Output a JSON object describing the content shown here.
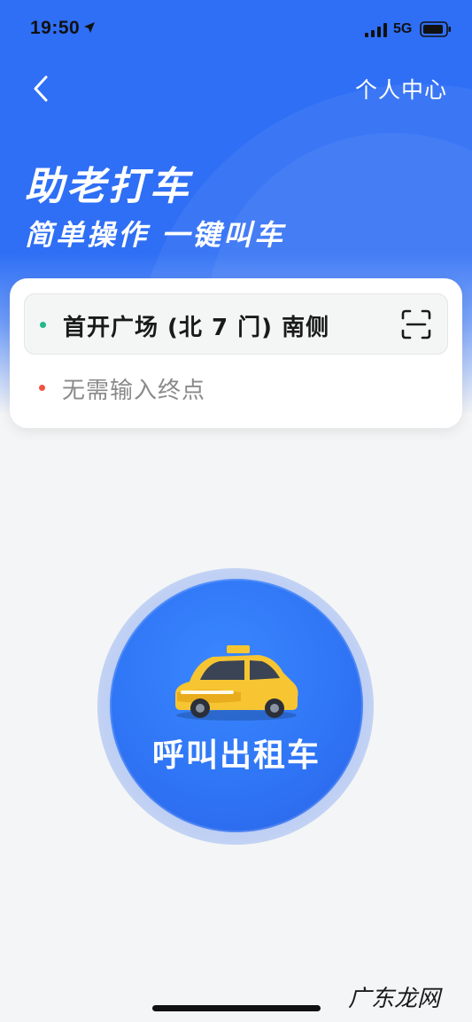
{
  "status": {
    "time": "19:50",
    "network": "5G"
  },
  "header": {
    "user_center": "个人中心"
  },
  "hero": {
    "title": "助老打车",
    "subtitle": "简单操作 一键叫车"
  },
  "route": {
    "origin": "首开广场 (北 7 门) 南侧",
    "destination_placeholder": "无需输入终点"
  },
  "call": {
    "label": "呼叫出租车"
  },
  "watermark": "广东龙网",
  "colors": {
    "primary": "#2f6ff5",
    "origin_dot": "#20b98a",
    "destination_dot": "#f25242",
    "taxi_yellow": "#f7c531"
  }
}
